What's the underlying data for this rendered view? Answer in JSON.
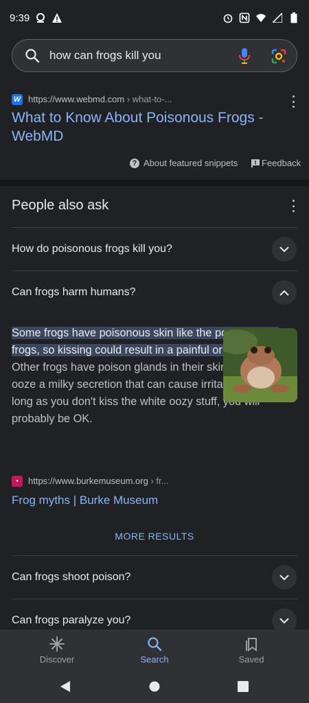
{
  "status_bar": {
    "time": "9:39"
  },
  "search": {
    "query": "how can frogs kill you"
  },
  "featured_result": {
    "favicon_letter": "W",
    "url": "https://www.webmd.com",
    "breadcrumb": " › what-to-...",
    "title": "What to Know About Poisonous Frogs - WebMD",
    "about_snippets": "About featured snippets",
    "feedback": "Feedback"
  },
  "paa": {
    "title": "People also ask",
    "questions": [
      "How do poisonous frogs kill you?",
      "Can frogs harm humans?",
      "Can frogs shoot poison?",
      "Can frogs paralyze you?"
    ],
    "answer_highlight": "Some frogs have poisonous skin like the poison arrow frogs, so kissing could result in a painful or quick death",
    "answer_rest": ". Other frogs have poison glands in their skin that can ooze a milky secretion that can cause irritation, but as long as you don't kiss the white oozy stuff, you will probably be OK.",
    "source_url": "https://www.burkemuseum.org",
    "source_breadcrumb": " › fr...",
    "source_title": "Frog myths | Burke Museum",
    "more_results": "MORE RESULTS"
  },
  "bottom_nav": {
    "discover": "Discover",
    "search": "Search",
    "saved": "Saved"
  },
  "colors": {
    "link": "#8ab4f8",
    "background": "#202124",
    "highlight": "#3c4760"
  }
}
